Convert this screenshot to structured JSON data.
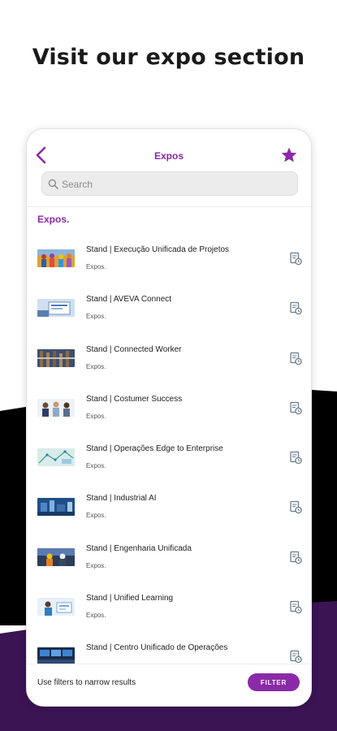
{
  "headline": "Visit our expo section",
  "colors": {
    "accent": "#8a2aa8",
    "dark_band": "#000000",
    "purple_band": "#3b1454"
  },
  "app": {
    "title": "Expos",
    "back_icon": "chevron-left-icon",
    "favorite_icon": "star-icon",
    "search": {
      "placeholder": "Search",
      "value": ""
    },
    "section_title": "Expos."
  },
  "items": [
    {
      "title": "Stand | Execução Unificada de Projetos",
      "subtitle": "Expos.",
      "thumb": "people-group"
    },
    {
      "title": "Stand | AVEVA Connect",
      "subtitle": "Expos.",
      "thumb": "connect-screen"
    },
    {
      "title": "Stand | Connected Worker",
      "subtitle": "Expos.",
      "thumb": "factory-pipes"
    },
    {
      "title": "Stand | Costumer Success",
      "subtitle": "Expos.",
      "thumb": "meeting-people"
    },
    {
      "title": "Stand | Operações Edge to Enterprise",
      "subtitle": "Expos.",
      "thumb": "map-network"
    },
    {
      "title": "Stand | Industrial AI",
      "subtitle": "Expos.",
      "thumb": "plant-blue"
    },
    {
      "title": "Stand | Engenharia Unificada",
      "subtitle": "Expos.",
      "thumb": "engineers-site"
    },
    {
      "title": "Stand | Unified Learning",
      "subtitle": "Expos.",
      "thumb": "learning-person"
    },
    {
      "title": "Stand | Centro Unificado de Operações",
      "subtitle": "",
      "thumb": "control-room"
    }
  ],
  "footer": {
    "hint": "Use filters to narrow results",
    "filter_label": "FILTER"
  }
}
